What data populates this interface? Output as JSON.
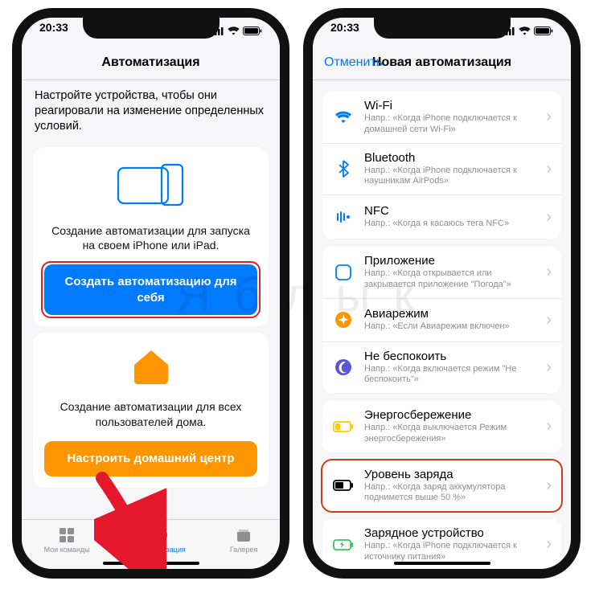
{
  "statusbar": {
    "time": "20:33"
  },
  "left": {
    "nav_title": "Автоматизация",
    "intro": "Настройте устройства, чтобы они реагировали на изменение определенных условий.",
    "personal": {
      "desc": "Создание автоматизации для запуска на своем iPhone или iPad.",
      "button": "Создать автоматизацию для себя"
    },
    "home": {
      "desc": "Создание автоматизации для всех пользователей дома.",
      "button": "Настроить домашний центр"
    },
    "tabs": {
      "library": "Мои команды",
      "automation": "Автоматизация",
      "gallery": "Галерея"
    }
  },
  "right": {
    "nav_cancel": "Отменить",
    "nav_title": "Новая автоматизация",
    "rows": {
      "wifi": {
        "title": "Wi-Fi",
        "sub": "Напр.: «Когда iPhone подключается к домашней сети Wi-Fi»"
      },
      "bluetooth": {
        "title": "Bluetooth",
        "sub": "Напр.: «Когда iPhone подключается к наушникам AirPods»"
      },
      "nfc": {
        "title": "NFC",
        "sub": "Напр.: «Когда я касаюсь тега NFC»"
      },
      "app": {
        "title": "Приложение",
        "sub": "Напр.: «Когда открывается или закрывается приложение \"Погода\"»"
      },
      "airplane": {
        "title": "Авиарежим",
        "sub": "Напр.: «Если Авиарежим включен»"
      },
      "dnd": {
        "title": "Не беспокоить",
        "sub": "Напр.: «Когда включается режим \"Не беспокоить\"»"
      },
      "lowpower": {
        "title": "Энергосбережение",
        "sub": "Напр.: «Когда выключается Режим энергосбережения»"
      },
      "battery": {
        "title": "Уровень заряда",
        "sub": "Напр.: «Когда заряд аккумулятора поднимется выше 50 %»"
      },
      "charger": {
        "title": "Зарядное устройство",
        "sub": "Напр.: «Когда iPhone подключается к источнику питания»"
      }
    }
  },
  "watermark": "Я б л ы к",
  "colors": {
    "accent": "#007aff",
    "orange": "#ff9500",
    "red": "#d22"
  }
}
